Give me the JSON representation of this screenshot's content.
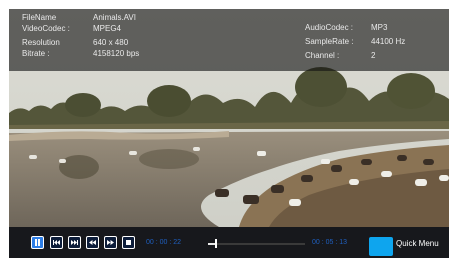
{
  "file_info": [
    {
      "key": "FileName",
      "value": "Animals.AVI"
    },
    {
      "key": "VideoCodec :",
      "value": "MPEG4"
    },
    {
      "key": "Resolution",
      "value": "640 x 480"
    },
    {
      "key": "Bitrate :",
      "value": "4158120 bps"
    }
  ],
  "audio_info": [
    {
      "key": "AudioCodec :",
      "value": "MP3"
    },
    {
      "key": "SampleRate :",
      "value": "44100 Hz"
    },
    {
      "key": "Channel :",
      "value": "2"
    }
  ],
  "controls": {
    "current_time": "00 : 00 : 22",
    "total_time": "00 : 05 : 13",
    "progress": 0.07,
    "quick_menu_label": "Quick Menu",
    "icons": [
      "pause-icon",
      "skip-previous-icon",
      "skip-next-icon",
      "rewind-icon",
      "fast-forward-icon",
      "stop-icon"
    ]
  },
  "colors": {
    "accent": "#2e7ee6",
    "quick_menu": "#0ea5ee",
    "time_text": "#1f5fbf",
    "control_bar": "#17181c"
  }
}
